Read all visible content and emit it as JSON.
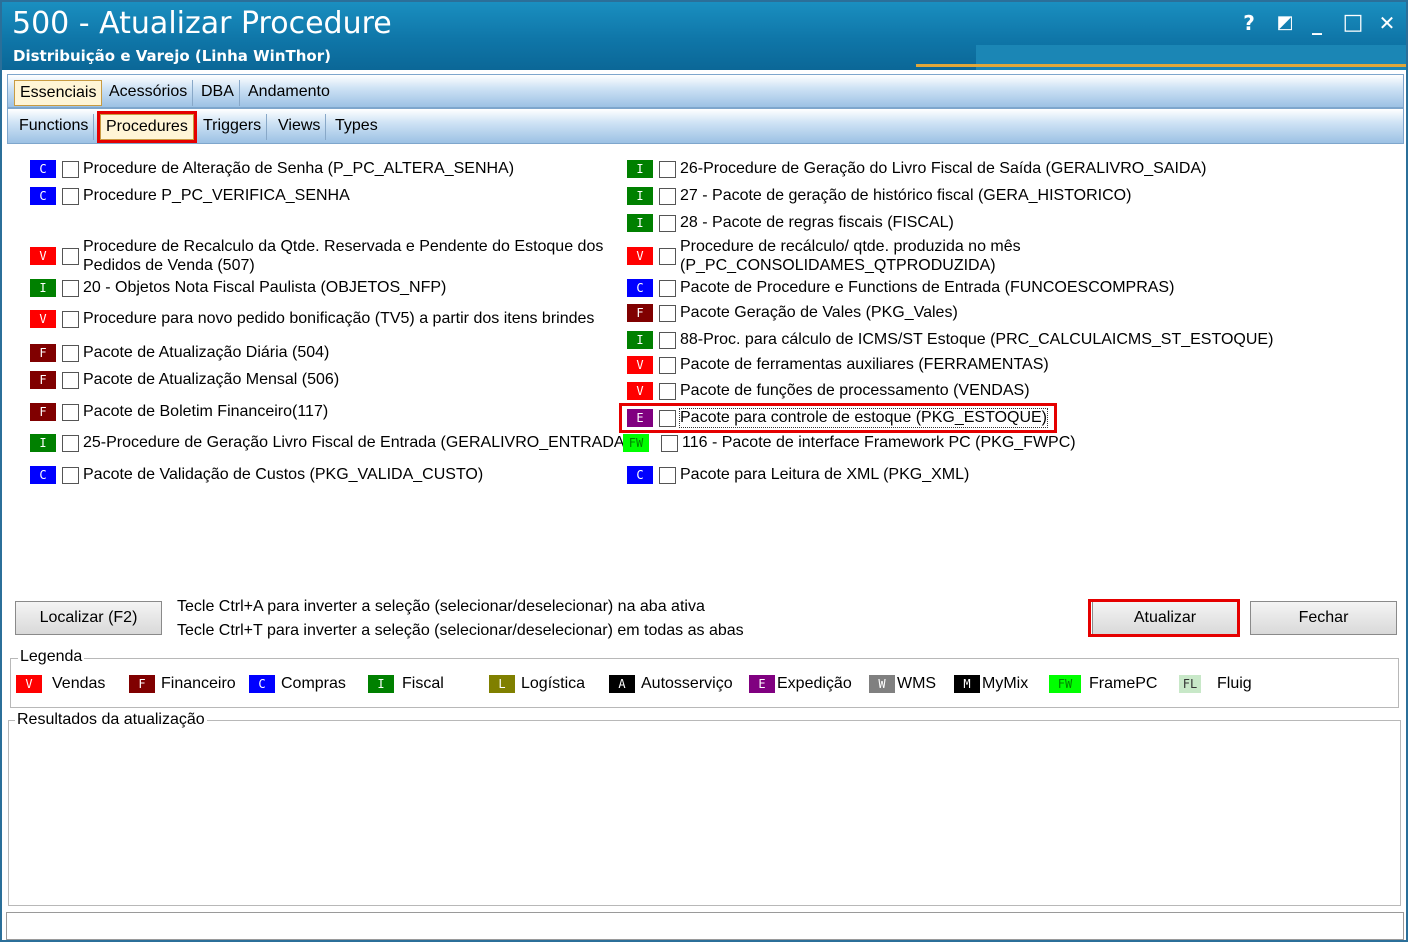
{
  "window": {
    "title": "500 - Atualizar Procedure",
    "subtitle": "Distribuição e Varejo (Linha WinThor)",
    "controls": [
      "?",
      "◩",
      "_",
      "□",
      "✕"
    ]
  },
  "tabs_top": [
    {
      "label": "Essenciais",
      "active": true
    },
    {
      "label": "Acessórios",
      "active": false
    },
    {
      "label": "DBA",
      "active": false
    },
    {
      "label": "Andamento",
      "active": false
    }
  ],
  "tabs_sub": [
    {
      "label": "Functions",
      "active": false
    },
    {
      "label": "Procedures",
      "active": true
    },
    {
      "label": "Triggers",
      "active": false
    },
    {
      "label": "Views",
      "active": false
    },
    {
      "label": "Types",
      "active": false
    }
  ],
  "left_items": [
    {
      "badge": "C",
      "label": "Procedure de Alteração de Senha (P_PC_ALTERA_SENHA)"
    },
    {
      "badge": "C",
      "label": "Procedure P_PC_VERIFICA_SENHA"
    },
    {
      "badge": "V",
      "label": "Procedure de Recalculo da Qtde. Reservada e Pendente do Estoque dos",
      "label2": "Pedidos de Venda (507)"
    },
    {
      "badge": "I",
      "label": "20 - Objetos Nota Fiscal Paulista (OBJETOS_NFP)"
    },
    {
      "badge": "V",
      "label": "Procedure para novo pedido bonificação (TV5) a partir dos itens brindes"
    },
    {
      "badge": "F",
      "label": "Pacote de Atualização Diária (504)"
    },
    {
      "badge": "F",
      "label": "Pacote de Atualização Mensal (506)"
    },
    {
      "badge": "F",
      "label": "Pacote de Boletim Financeiro(117)"
    },
    {
      "badge": "I",
      "label": "25-Procedure de Geração Livro Fiscal de Entrada (GERALIVRO_ENTRADA)"
    },
    {
      "badge": "C",
      "label": "Pacote de Validação de Custos (PKG_VALIDA_CUSTO)"
    }
  ],
  "right_items": [
    {
      "badge": "I",
      "label": "26-Procedure de Geração do Livro Fiscal de Saída (GERALIVRO_SAIDA)"
    },
    {
      "badge": "I",
      "label": "27 - Pacote de geração de histórico fiscal (GERA_HISTORICO)"
    },
    {
      "badge": "I",
      "label": "28 - Pacote de regras fiscais (FISCAL)"
    },
    {
      "badge": "V",
      "label": "Procedure de recálculo/ qtde. produzida no mês",
      "label2": "(P_PC_CONSOLIDAMES_QTPRODUZIDA)"
    },
    {
      "badge": "C",
      "label": "Pacote de Procedure e Functions de Entrada (FUNCOESCOMPRAS)"
    },
    {
      "badge": "F",
      "label": "Pacote Geração de Vales (PKG_Vales)"
    },
    {
      "badge": "I",
      "label": "88-Proc. para cálculo de ICMS/ST Estoque (PRC_CALCULAICMS_ST_ESTOQUE)"
    },
    {
      "badge": "V",
      "label": "Pacote de ferramentas auxiliares (FERRAMENTAS)"
    },
    {
      "badge": "V",
      "label": "Pacote de funções de processamento (VENDAS)"
    },
    {
      "badge": "E",
      "label": "Pacote para controle de estoque (PKG_ESTOQUE)"
    },
    {
      "badge": "FW",
      "label": "116 - Pacote de interface Framework PC (PKG_FWPC)"
    },
    {
      "badge": "C",
      "label": "Pacote para Leitura de XML (PKG_XML)"
    }
  ],
  "buttons": {
    "localizar": "Localizar (F2)",
    "atualizar": "Atualizar",
    "fechar": "Fechar"
  },
  "hints": {
    "line1": "Tecle Ctrl+A para inverter a seleção (selecionar/deselecionar) na aba ativa",
    "line2": "Tecle Ctrl+T para inverter a seleção (selecionar/deselecionar) em todas as abas"
  },
  "legend": {
    "title": "Legenda",
    "items": [
      {
        "badge": "V",
        "label": "Vendas"
      },
      {
        "badge": "F",
        "label": "Financeiro"
      },
      {
        "badge": "C",
        "label": "Compras"
      },
      {
        "badge": "I",
        "label": "Fiscal"
      },
      {
        "badge": "L",
        "label": "Logística"
      },
      {
        "badge": "A",
        "label": "Autosserviço"
      },
      {
        "badge": "E",
        "label": "Expedição"
      },
      {
        "badge": "W",
        "label": "WMS"
      },
      {
        "badge": "M",
        "label": "MyMix"
      },
      {
        "badge": "FW",
        "label": "FramePC"
      },
      {
        "badge": "FL",
        "label": "Fluig"
      }
    ]
  },
  "results": {
    "title": "Resultados da atualização"
  },
  "badge_colors": {
    "V": {
      "bg": "#ff0000",
      "fg": "#ffffff"
    },
    "F": {
      "bg": "#800000",
      "fg": "#ffffff"
    },
    "C": {
      "bg": "#0000ff",
      "fg": "#ffffff"
    },
    "I": {
      "bg": "#008000",
      "fg": "#ffffff"
    },
    "L": {
      "bg": "#808000",
      "fg": "#ffffff"
    },
    "A": {
      "bg": "#000000",
      "fg": "#ffffff"
    },
    "E": {
      "bg": "#800080",
      "fg": "#ffffff"
    },
    "W": {
      "bg": "#808080",
      "fg": "#ffffff"
    },
    "M": {
      "bg": "#000000",
      "fg": "#ffffff"
    },
    "FW": {
      "bg": "#00ff00",
      "fg": "#008000"
    },
    "FL": {
      "bg": "#c8e8c8",
      "fg": "#333333"
    }
  }
}
